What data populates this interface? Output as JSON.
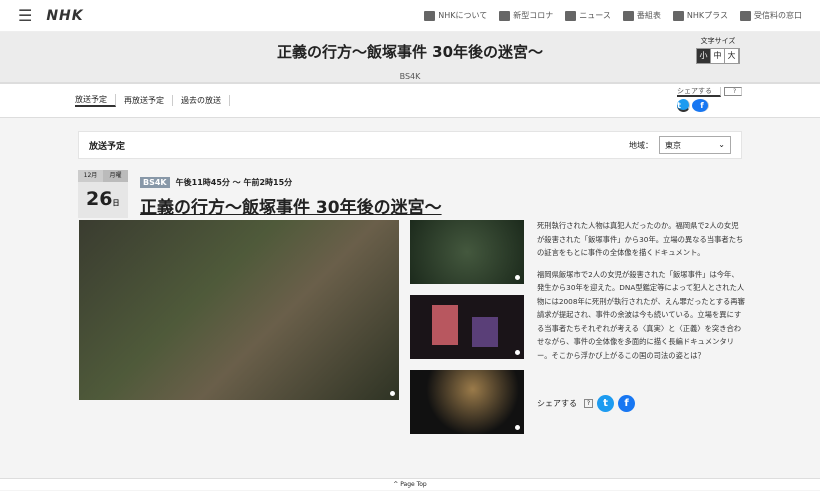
{
  "header": {
    "menu_icon": "hamburger-icon",
    "logo": "NHK",
    "nav": [
      "NHKについて",
      "新型コロナ",
      "ニュース",
      "番組表",
      "NHKプラス",
      "受信料の窓口"
    ]
  },
  "hero": {
    "title": "正義の行方～飯塚事件 30年後の迷宮～",
    "channel": "BS4K",
    "font_size_label": "文字サイズ",
    "font_sizes": [
      "小",
      "中",
      "大"
    ]
  },
  "subnav": {
    "tabs": [
      "放送予定",
      "再放送予定",
      "過去の放送"
    ],
    "share_label": "シェアする",
    "help": "?"
  },
  "schedule": {
    "heading": "放送予定",
    "region_label": "地域：",
    "region_value": "東京"
  },
  "program": {
    "month": "12月",
    "weekday": "月曜",
    "day": "26",
    "day_suffix": "日",
    "badge": "BS4K",
    "time": "午後11時45分 ～ 午前2時15分",
    "title": "正義の行方～飯塚事件 30年後の迷宮～",
    "description": [
      "死刑執行された人物は真犯人だったのか。福岡県で2人の女児が殺害された「飯塚事件」から30年。立場の異なる当事者たちの証言をもとに事件の全体像を描くドキュメント。",
      "福岡県飯塚市で2人の女児が殺害された「飯塚事件」は今年、発生から30年を迎えた。DNA型鑑定等によって犯人とされた人物には2008年に死刑が執行されたが、えん罪だったとする再審請求が提起され、事件の余波は今も続いている。立場を異にする当事者たちそれぞれが考える〈真実〉と〈正義〉を突き合わせながら、事件の全体像を多面的に描く長編ドキュメンタリー。そこから浮かび上がるこの国の司法の姿とは？"
    ],
    "share_label": "シェアする",
    "help": "?"
  },
  "footer": {
    "page_top": "Page Top"
  }
}
